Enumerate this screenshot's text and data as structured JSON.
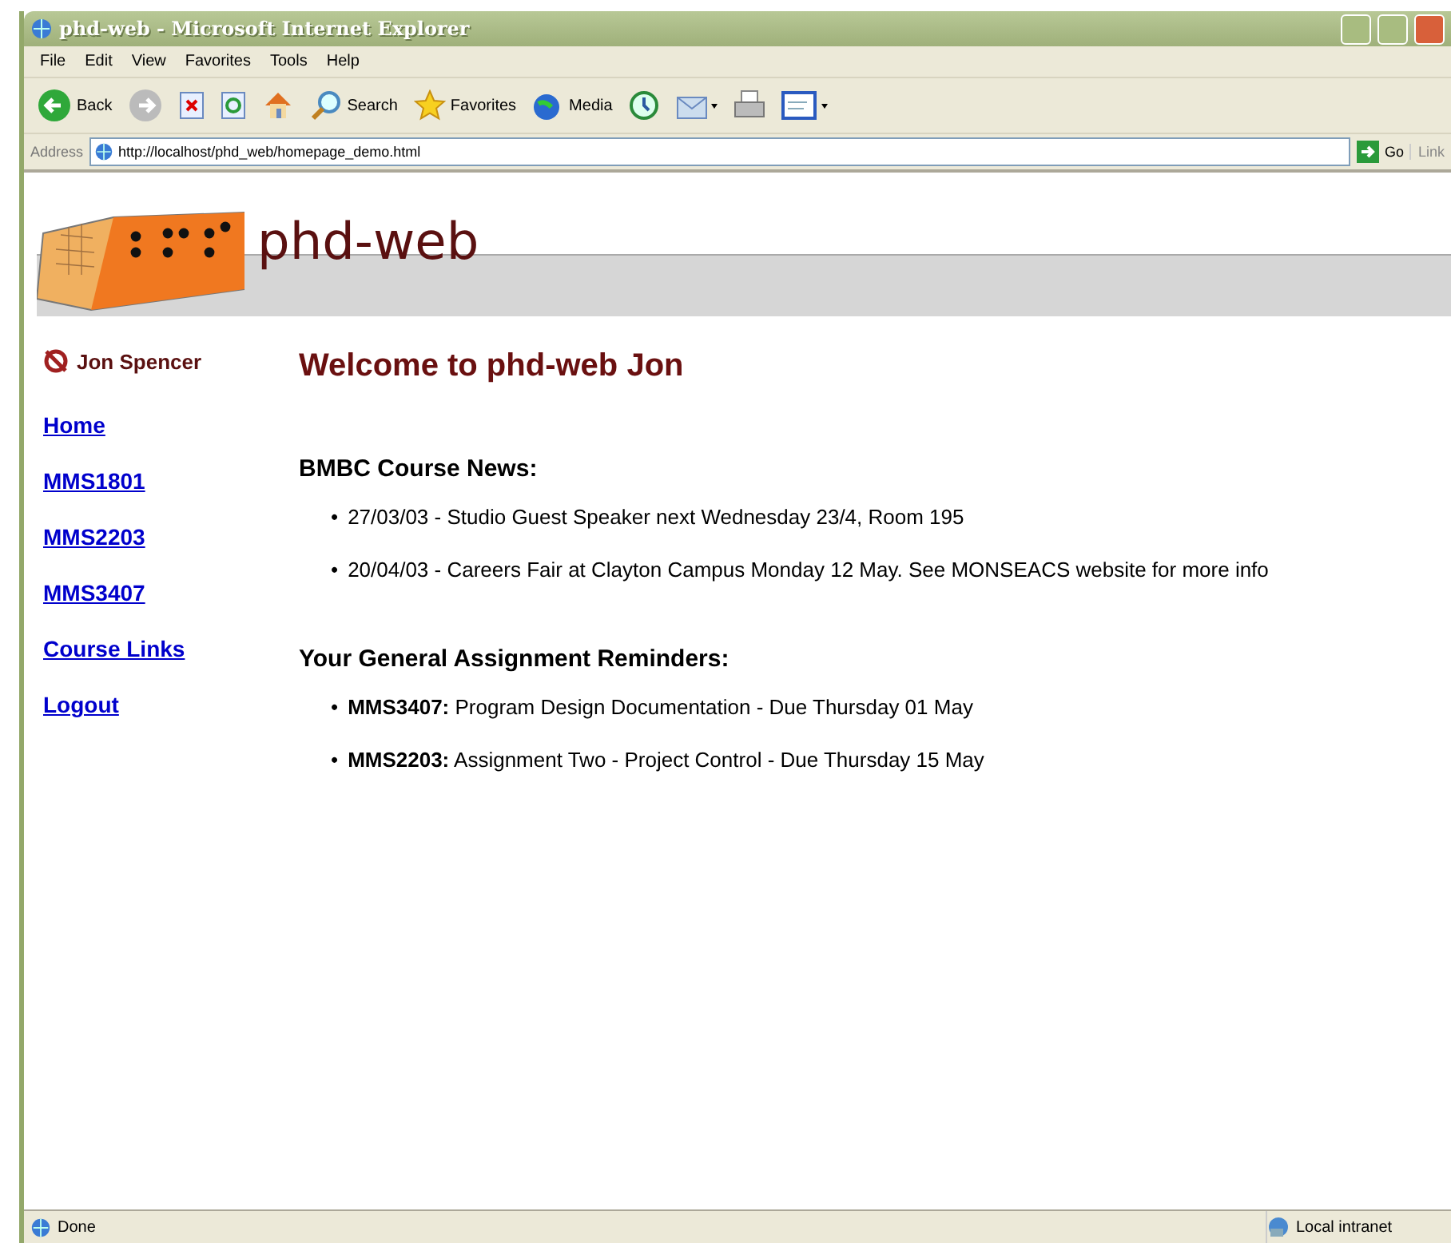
{
  "window": {
    "title": "phd-web - Microsoft Internet Explorer"
  },
  "menu": [
    "File",
    "Edit",
    "View",
    "Favorites",
    "Tools",
    "Help"
  ],
  "toolbar": [
    {
      "kind": "back",
      "label": "Back"
    },
    {
      "kind": "forward"
    },
    {
      "kind": "stop"
    },
    {
      "kind": "refresh"
    },
    {
      "kind": "home"
    },
    {
      "kind": "search",
      "label": "Search"
    },
    {
      "kind": "favorites",
      "label": "Favorites"
    },
    {
      "kind": "media",
      "label": "Media"
    },
    {
      "kind": "history"
    },
    {
      "kind": "mail"
    },
    {
      "kind": "print"
    },
    {
      "kind": "edit"
    }
  ],
  "address": {
    "label": "Address",
    "value": "http://localhost/phd_web/homepage_demo.html",
    "go": "Go",
    "links": "Link"
  },
  "site": {
    "title": "phd-web"
  },
  "user": {
    "name": "Jon Spencer"
  },
  "nav": [
    "Home",
    "MMS1801",
    "MMS2203",
    "MMS3407",
    "Course Links",
    "Logout"
  ],
  "heading": "Welcome to phd-web Jon",
  "sections": [
    {
      "title": "BMBC Course News:",
      "items": [
        {
          "bullet": "•",
          "text": "27/03/03 - Studio Guest Speaker next Wednesday 23/4, Room 195"
        },
        {
          "bullet": "•",
          "text": "20/04/03 - Careers Fair at Clayton Campus Monday 12 May. See MONSEACS website for more info"
        }
      ]
    },
    {
      "title": "Your General Assignment Reminders:",
      "items": [
        {
          "bullet": "•",
          "text": "**MMS3407:** Program Design Documentation - Due Thursday 01 May"
        },
        {
          "bullet": "•",
          "text": "**MMS2203:** Assignment Two - Project Control - Due Thursday 15 May"
        }
      ]
    }
  ],
  "status_bar": {
    "text": "Done",
    "zone": "Local intranet"
  }
}
